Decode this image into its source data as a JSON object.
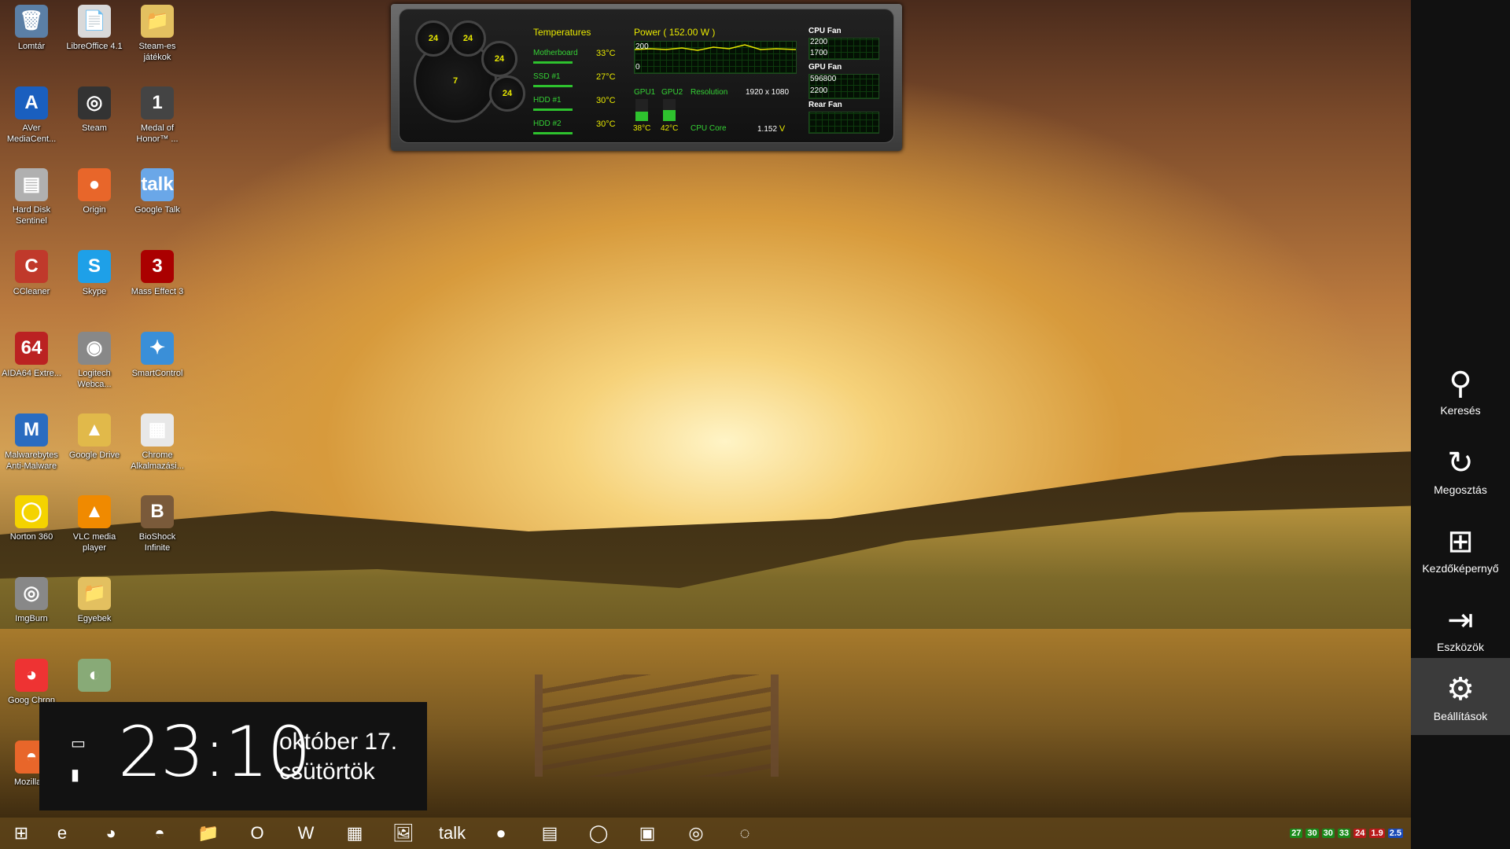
{
  "desktop": {
    "icons": [
      {
        "label": "Lomtár",
        "glyph": "🗑",
        "color": "#5b7fa6"
      },
      {
        "label": "LibreOffice 4.1",
        "glyph": "📄",
        "color": "#d9d9d9"
      },
      {
        "label": "Steam-es játékok",
        "glyph": "📁",
        "color": "#e3c060"
      },
      {
        "label": "AVer MediaCent...",
        "glyph": "A",
        "color": "#1a5fbf"
      },
      {
        "label": "Steam",
        "glyph": "◎",
        "color": "#333"
      },
      {
        "label": "Medal of Honor™ ...",
        "glyph": "1",
        "color": "#444"
      },
      {
        "label": "Hard Disk Sentinel",
        "glyph": "▤",
        "color": "#b0b0b0"
      },
      {
        "label": "Origin",
        "glyph": "●",
        "color": "#e8662a"
      },
      {
        "label": "Google Talk",
        "glyph": "talk",
        "color": "#6aa7e8"
      },
      {
        "label": "CCleaner",
        "glyph": "C",
        "color": "#c0392b"
      },
      {
        "label": "Skype",
        "glyph": "S",
        "color": "#1ea0e8"
      },
      {
        "label": "Mass Effect 3",
        "glyph": "3",
        "color": "#a00"
      },
      {
        "label": "AIDA64 Extre...",
        "glyph": "64",
        "color": "#b22"
      },
      {
        "label": "Logitech Webca...",
        "glyph": "◉",
        "color": "#888"
      },
      {
        "label": "SmartControl",
        "glyph": "✦",
        "color": "#3a8fd8"
      },
      {
        "label": "Malwarebytes Anti-Malware",
        "glyph": "M",
        "color": "#2a6cc0"
      },
      {
        "label": "Google Drive",
        "glyph": "▲",
        "color": "#e1b94a"
      },
      {
        "label": "Chrome Alkalmazási...",
        "glyph": "▦",
        "color": "#e8e8e8"
      },
      {
        "label": "Norton 360",
        "glyph": "◯",
        "color": "#f4d300"
      },
      {
        "label": "VLC media player",
        "glyph": "▲",
        "color": "#f08a00"
      },
      {
        "label": "BioShock Infinite",
        "glyph": "B",
        "color": "#7a5a3a"
      },
      {
        "label": "ImgBurn",
        "glyph": "◎",
        "color": "#888"
      },
      {
        "label": "Egyebek",
        "glyph": "📁",
        "color": "#e3c060"
      },
      {
        "label": "Goog Chron",
        "glyph": "◕",
        "color": "#e33"
      },
      {
        "label": "",
        "glyph": "◐",
        "color": "#8a7"
      },
      {
        "label": "Mozilla F",
        "glyph": "◓",
        "color": "#e8662a"
      }
    ]
  },
  "gadget": {
    "gauges": [
      "24",
      "24",
      "24",
      "24",
      "7"
    ],
    "temperatures_title": "Temperatures",
    "power_title": "Power",
    "power_value": "152.00 W",
    "rows": [
      {
        "name": "Motherboard",
        "value": "33",
        "unit": "°C"
      },
      {
        "name": "SSD #1",
        "value": "27",
        "unit": "°C"
      },
      {
        "name": "HDD #1",
        "value": "30",
        "unit": "°C"
      },
      {
        "name": "HDD #2",
        "value": "30",
        "unit": "°C"
      }
    ],
    "power_scale_top": "200",
    "power_scale_bottom": "0",
    "gpu1_label": "GPU1",
    "gpu2_label": "GPU2",
    "gpu1_temp": "38",
    "gpu2_temp": "42",
    "temp_unit": "°C",
    "resolution_label": "Resolution",
    "resolution_value": "1920 x 1080",
    "cpu_core_label": "CPU Core",
    "cpu_core_value": "1.152",
    "cpu_core_unit": "V",
    "cpu_fan_label": "CPU Fan",
    "cpu_fan_top": "2200",
    "cpu_fan_bottom": "1700",
    "gpu_fan_label": "GPU Fan",
    "gpu_fan_top": "596800",
    "gpu_fan_bottom": "2200",
    "rear_fan_label": "Rear Fan"
  },
  "clock": {
    "time": "23:10",
    "date": "október 17.",
    "day": "csütörtök"
  },
  "charms": [
    {
      "label": "Keresés",
      "icon": "search-icon",
      "glyph": "⚲"
    },
    {
      "label": "Megosztás",
      "icon": "share-icon",
      "glyph": "↻"
    },
    {
      "label": "Kezdőképernyő",
      "icon": "windows-icon",
      "glyph": "⊞"
    },
    {
      "label": "Eszközök",
      "icon": "devices-icon",
      "glyph": "⇥"
    },
    {
      "label": "Beállítások",
      "icon": "gear-icon",
      "glyph": "⚙"
    }
  ],
  "taskbar": {
    "items": [
      {
        "name": "start-button",
        "glyph": "⊞"
      },
      {
        "name": "internet-explorer",
        "glyph": "e"
      },
      {
        "name": "chrome",
        "glyph": "◕"
      },
      {
        "name": "firefox",
        "glyph": "◓"
      },
      {
        "name": "file-explorer",
        "glyph": "📁"
      },
      {
        "name": "outlook",
        "glyph": "O"
      },
      {
        "name": "word",
        "glyph": "W"
      },
      {
        "name": "control-panel",
        "glyph": "▦"
      },
      {
        "name": "photo-viewer",
        "glyph": "🖼"
      },
      {
        "name": "google-talk",
        "glyph": "talk"
      },
      {
        "name": "origin",
        "glyph": "●"
      },
      {
        "name": "hard-disk-sentinel",
        "glyph": "▤"
      },
      {
        "name": "norton",
        "glyph": "◯"
      },
      {
        "name": "store",
        "glyph": "▣"
      },
      {
        "name": "steam",
        "glyph": "◎"
      },
      {
        "name": "remote",
        "glyph": "◌"
      }
    ],
    "tray": [
      "27",
      "30",
      "30",
      "33",
      "24",
      "1.9",
      "2.5"
    ]
  }
}
